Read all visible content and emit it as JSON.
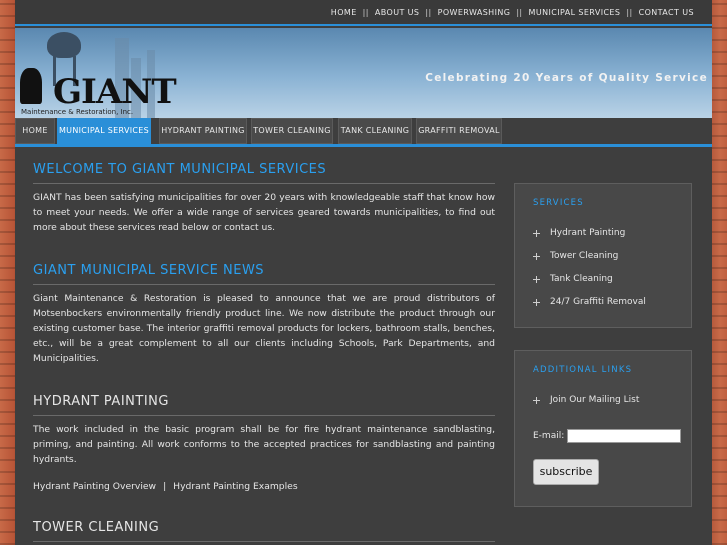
{
  "top_nav": [
    "HOME",
    "ABOUT US",
    "POWERWASHING",
    "MUNICIPAL SERVICES",
    "CONTACT US"
  ],
  "top_nav_separator": "||",
  "banner": {
    "logo_text": "GIANT",
    "logo_subtitle": "Maintenance & Restoration, Inc.",
    "tagline": "Celebrating 20 Years of Quality Service"
  },
  "main_nav": [
    {
      "label": "HOME",
      "active": false
    },
    {
      "label": "MUNICIPAL SERVICES",
      "active": true
    },
    {
      "label": "HYDRANT PAINTING",
      "active": false
    },
    {
      "label": "TOWER CLEANING",
      "active": false
    },
    {
      "label": "TANK CLEANING",
      "active": false
    },
    {
      "label": "GRAFFITI REMOVAL",
      "active": false
    }
  ],
  "content": {
    "welcome_title": "WELCOME TO GIANT MUNICIPAL SERVICES",
    "welcome_text": "GIANT has been satisfying municipalities for over 20 years with knowledgeable staff that know how to meet your needs. We offer a wide range of services geared towards municipalities, to find out more about these services read below or contact us.",
    "news_title": "GIANT MUNICIPAL SERVICE NEWS",
    "news_text": "Giant Maintenance & Restoration is pleased to announce that we are proud distributors of Motsenbockers environmentally friendly product line. We now distribute the product through our existing customer base. The interior graffiti removal products for lockers, bathroom stalls, benches, etc., will be a great complement to all our clients including Schools, Park Departments, and Municipalities.",
    "hydrant_title": "HYDRANT PAINTING",
    "hydrant_text": "The work included in the basic program shall be for fire hydrant maintenance sandblasting, priming, and painting. All work conforms to the accepted practices for sandblasting and painting hydrants.",
    "hydrant_link_1": "Hydrant Painting Overview",
    "hydrant_link_sep": "|",
    "hydrant_link_2": "Hydrant Painting Examples",
    "tower_title": "TOWER CLEANING"
  },
  "services_box": {
    "title": "SERVICES",
    "items": [
      "Hydrant Painting",
      "Tower Cleaning",
      "Tank Cleaning",
      "24/7 Graffiti Removal"
    ]
  },
  "links_box": {
    "title": "ADDITIONAL LINKS",
    "items": [
      "Join Our Mailing List"
    ],
    "email_label": "E-mail:",
    "email_value": "",
    "subscribe_label": "subscribe"
  },
  "colors": {
    "accent": "#2a8fd8",
    "heading_blue": "#2aa0f0",
    "panel_bg": "#3e3e3e"
  }
}
